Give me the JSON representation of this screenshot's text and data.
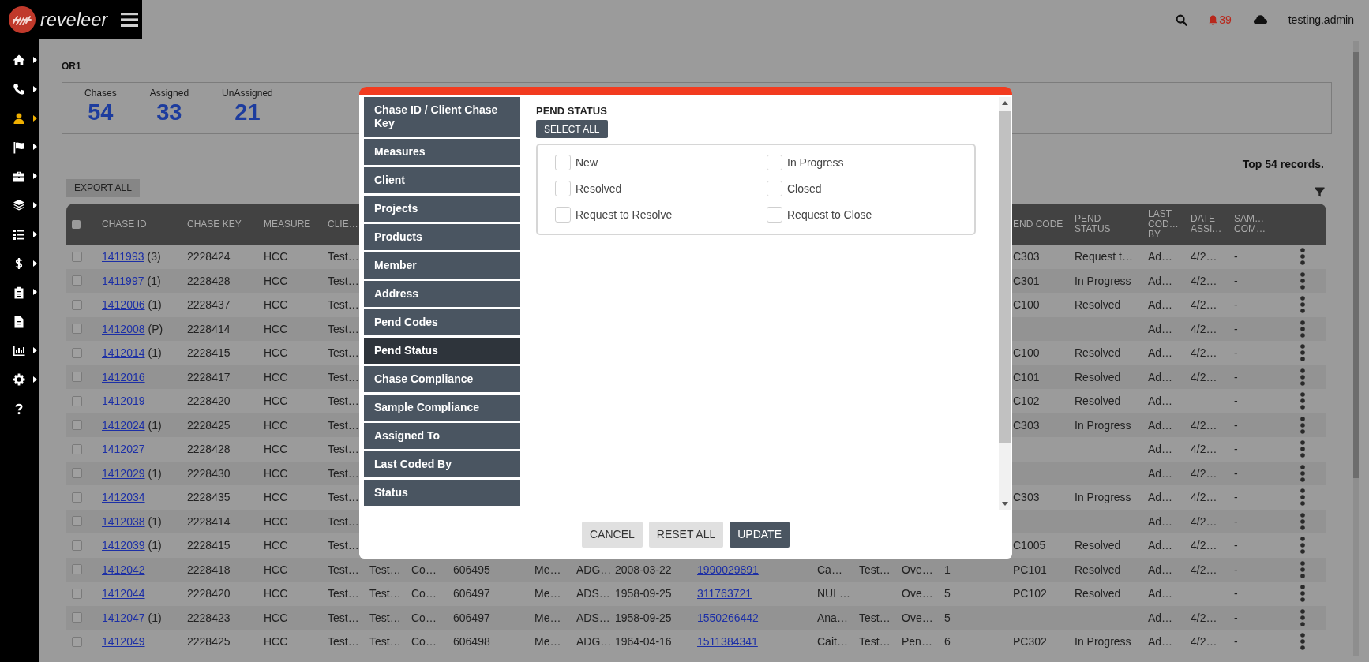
{
  "header": {
    "brand": "reveleer",
    "notifications": "39",
    "user": "testing.admin"
  },
  "nav": [
    {
      "selected": false,
      "submenu": true
    },
    {
      "selected": false,
      "submenu": true
    },
    {
      "selected": true,
      "submenu": true
    },
    {
      "selected": false,
      "submenu": true
    },
    {
      "selected": false,
      "submenu": true
    },
    {
      "selected": false,
      "submenu": true
    },
    {
      "selected": false,
      "submenu": true
    },
    {
      "selected": false,
      "submenu": true
    },
    {
      "selected": false,
      "submenu": true
    },
    {
      "selected": false,
      "submenu": false
    },
    {
      "selected": false,
      "submenu": true
    },
    {
      "selected": false,
      "submenu": true
    },
    {
      "selected": false,
      "submenu": false
    }
  ],
  "page": {
    "title": "OR1",
    "stats": [
      {
        "label": "Chases",
        "value": "54"
      },
      {
        "label": "Assigned",
        "value": "33"
      },
      {
        "label": "UnAssigned",
        "value": "21"
      }
    ],
    "record_count": "Top 54 records.",
    "export_button": "EXPORT ALL"
  },
  "table": {
    "select_all_checked": false,
    "columns": {
      "chase_id": "CHASE ID",
      "chase_key": "CHASE KEY",
      "measure": "MEASURE",
      "client": "CLIE…",
      "pend_code": "END CODE",
      "pend_status": "PEND STATUS",
      "last_cod_by": "LAST COD… BY",
      "date_assi": "DATE ASSI…",
      "sam_com": "SAM… COM…"
    },
    "rows": [
      {
        "checked": false,
        "chase_id": "1411993",
        "chase_note": "(3)",
        "chase_key": "2228424",
        "measure": "HCC",
        "client": "Test…",
        "pend_code": "C303",
        "pend_status": "Request t…",
        "last_cod_by": "Ad…",
        "date_assi": "4/2…",
        "sam_com": "-"
      },
      {
        "checked": false,
        "chase_id": "1411997",
        "chase_note": "(1)",
        "chase_key": "2228428",
        "measure": "HCC",
        "client": "Test…",
        "pend_code": "C301",
        "pend_status": "In Progress",
        "last_cod_by": "Ad…",
        "date_assi": "4/2…",
        "sam_com": "-"
      },
      {
        "checked": false,
        "chase_id": "1412006",
        "chase_note": "(1)",
        "chase_key": "2228437",
        "measure": "HCC",
        "client": "Test…",
        "pend_code": "C100",
        "pend_status": "Resolved",
        "last_cod_by": "Ad…",
        "date_assi": "4/2…",
        "sam_com": "-"
      },
      {
        "checked": false,
        "chase_id": "1412008",
        "chase_note": "(P)",
        "chase_key": "2228414",
        "measure": "HCC",
        "client": "Test…",
        "last_cod_by": "Ad…",
        "date_assi": "4/2…",
        "sam_com": "-"
      },
      {
        "checked": false,
        "chase_id": "1412014",
        "chase_note": "(1)",
        "chase_key": "2228415",
        "measure": "HCC",
        "client": "Test…",
        "pend_code": "C100",
        "pend_status": "Resolved",
        "last_cod_by": "Ad…",
        "date_assi": "4/2…",
        "sam_com": "-"
      },
      {
        "checked": false,
        "chase_id": "1412016",
        "chase_key": "2228417",
        "measure": "HCC",
        "client": "Test…",
        "pend_code": "C101",
        "pend_status": "Resolved",
        "last_cod_by": "Ad…",
        "date_assi": "4/2…",
        "sam_com": "-"
      },
      {
        "checked": false,
        "chase_id": "1412019",
        "chase_key": "2228420",
        "measure": "HCC",
        "client": "Test…",
        "pend_code": "C102",
        "pend_status": "Resolved",
        "last_cod_by": "Ad…",
        "sam_com": "-"
      },
      {
        "checked": false,
        "chase_id": "1412024",
        "chase_note": "(1)",
        "chase_key": "2228425",
        "measure": "HCC",
        "client": "Test…",
        "pend_code": "C303",
        "pend_status": "In Progress",
        "last_cod_by": "Ad…",
        "date_assi": "4/2…",
        "sam_com": "-"
      },
      {
        "checked": false,
        "chase_id": "1412027",
        "chase_key": "2228428",
        "measure": "HCC",
        "client": "Test…",
        "last_cod_by": "Ad…",
        "date_assi": "4/2…",
        "sam_com": "-"
      },
      {
        "checked": false,
        "chase_id": "1412029",
        "chase_note": "(1)",
        "chase_key": "2228430",
        "measure": "HCC",
        "client": "Test…",
        "last_cod_by": "Ad…",
        "date_assi": "4/2…",
        "sam_com": "-"
      },
      {
        "checked": false,
        "chase_id": "1412034",
        "chase_key": "2228435",
        "measure": "HCC",
        "client": "Test…",
        "pend_code": "C303",
        "pend_status": "In Progress",
        "last_cod_by": "Ad…",
        "date_assi": "4/2…",
        "sam_com": "-"
      },
      {
        "checked": false,
        "chase_id": "1412038",
        "chase_note": "(1)",
        "chase_key": "2228414",
        "measure": "HCC",
        "client": "Test…",
        "last_cod_by": "Ad…",
        "date_assi": "4/2…",
        "sam_com": "-"
      },
      {
        "checked": false,
        "chase_id": "1412039",
        "chase_note": "(1)",
        "chase_key": "2228415",
        "measure": "HCC",
        "client": "Test…",
        "pend_code": "C1005",
        "pend_status": "Resolved",
        "last_cod_by": "Ad…",
        "date_assi": "4/2…",
        "sam_com": "-"
      },
      {
        "checked": false,
        "chase_id": "1412042",
        "chase_key": "2228418",
        "measure": "HCC",
        "client": "Test…",
        "column_6": "Test…",
        "column_7": "Co…",
        "column_8": "606495",
        "column_9": "Me…",
        "column_10": "ADG…",
        "column_11": "2008-03-22",
        "column_12": "1990029891",
        "column_13": "Ca…",
        "column_14": "Test…",
        "column_15": "Ove…",
        "column_16": "1",
        "pend_code": "PC101",
        "pend_status": "Resolved",
        "last_cod_by": "Ad…",
        "date_assi": "4/2…",
        "sam_com": "-"
      },
      {
        "checked": false,
        "chase_id": "1412044",
        "chase_key": "2228420",
        "measure": "HCC",
        "client": "Test…",
        "column_6": "Test…",
        "column_7": "Co…",
        "column_8": "606497",
        "column_9": "Me…",
        "column_10": "ADS…",
        "column_11": "1958-09-25",
        "column_12": "311763721",
        "column_13": "NUL…",
        "column_15": "Ove…",
        "column_16": "5",
        "pend_code": "PC102",
        "pend_status": "Resolved",
        "last_cod_by": "Ad…",
        "sam_com": "-"
      },
      {
        "checked": false,
        "chase_id": "1412047",
        "chase_note": "(1)",
        "chase_key": "2228423",
        "measure": "HCC",
        "client": "Test…",
        "column_6": "Test…",
        "column_7": "Co…",
        "column_8": "606497",
        "column_9": "Me…",
        "column_10": "ADS…",
        "column_11": "1958-09-25",
        "column_12": "1550266442",
        "column_13": "Ana…",
        "column_14": "Test…",
        "column_15": "Ove…",
        "column_16": "5",
        "last_cod_by": "Ad…",
        "date_assi": "4/2…",
        "sam_com": "-"
      },
      {
        "checked": false,
        "chase_id": "1412049",
        "chase_key": "2228425",
        "measure": "HCC",
        "client": "Test…",
        "column_6": "Test…",
        "column_7": "Co…",
        "column_8": "606498",
        "column_9": "Me…",
        "column_10": "ADG…",
        "column_11": "1964-04-16",
        "column_12": "1511384341",
        "column_13": "Cait…",
        "column_14": "Test…",
        "column_15": "Pen…",
        "column_16": "6",
        "pend_code": "PC302",
        "pend_status": "In Progress",
        "last_cod_by": "Ad…",
        "date_assi": "4/2…",
        "sam_com": "-"
      }
    ]
  },
  "modal": {
    "categories": [
      {
        "label": "Chase ID / Client Chase Key",
        "selected": false
      },
      {
        "label": "Measures",
        "selected": false
      },
      {
        "label": "Client",
        "selected": false
      },
      {
        "label": "Projects",
        "selected": false
      },
      {
        "label": "Products",
        "selected": false
      },
      {
        "label": "Member",
        "selected": false
      },
      {
        "label": "Address",
        "selected": false
      },
      {
        "label": "Pend Codes",
        "selected": false
      },
      {
        "label": "Pend Status",
        "selected": true
      },
      {
        "label": "Chase Compliance",
        "selected": false
      },
      {
        "label": "Sample Compliance",
        "selected": false
      },
      {
        "label": "Assigned To",
        "selected": false
      },
      {
        "label": "Last Coded By",
        "selected": false
      },
      {
        "label": "Status",
        "selected": false
      }
    ],
    "section_title": "PEND STATUS",
    "select_all": "SELECT ALL",
    "options": [
      {
        "label": "New",
        "checked": false
      },
      {
        "label": "In Progress",
        "checked": false
      },
      {
        "label": "Resolved",
        "checked": false
      },
      {
        "label": "Closed",
        "checked": false
      },
      {
        "label": "Request to Resolve",
        "checked": false
      },
      {
        "label": "Request to Close",
        "checked": false
      }
    ],
    "buttons": [
      {
        "label": "CANCEL",
        "kind": "plain"
      },
      {
        "label": "RESET ALL",
        "kind": "plain"
      },
      {
        "label": "UPDATE",
        "kind": "primary"
      }
    ]
  }
}
